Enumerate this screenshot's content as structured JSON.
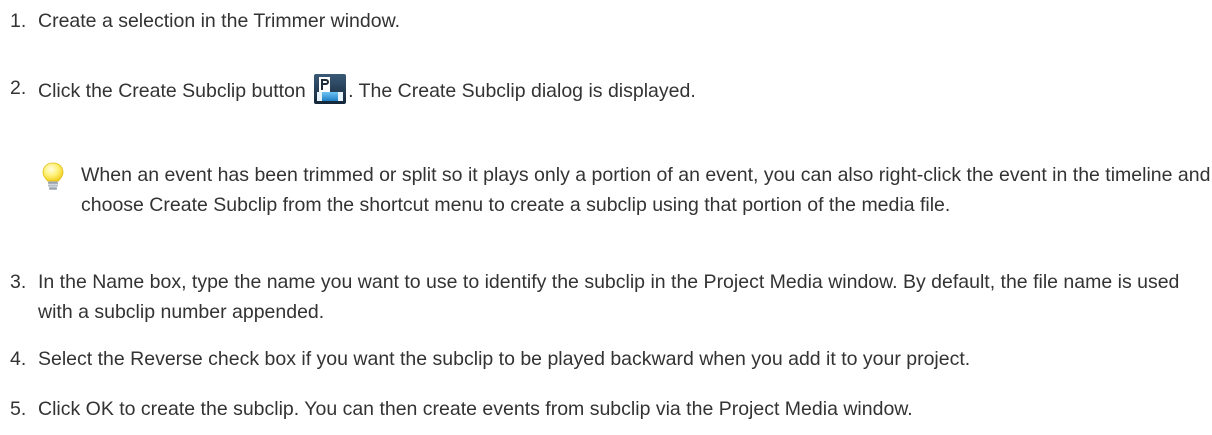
{
  "steps": [
    {
      "number": "1.",
      "text": "Create a selection in the Trimmer window."
    },
    {
      "number": "2.",
      "text_before_icon": "Click the Create Subclip button ",
      "text_after_icon": ". The Create Subclip dialog is displayed.",
      "icon": "create-subclip-icon"
    },
    {
      "number": "3.",
      "text": "In the Name box, type the name you want to use to identify the subclip in the Project Media window. By default, the file name is used with a subclip number appended."
    },
    {
      "number": "4.",
      "text": "Select the Reverse check box if you want the subclip to be played backward when you add it to your project."
    },
    {
      "number": "5.",
      "text": "Click OK to create the subclip. You can then create events from subclip via the Project Media window."
    }
  ],
  "tip": {
    "icon": "lightbulb-icon",
    "text": "When an event has been trimmed or split so it plays only a portion of an event, you can also right-click the event in the timeline and choose Create Subclip from the shortcut menu to create a subclip using that portion of the media file."
  }
}
